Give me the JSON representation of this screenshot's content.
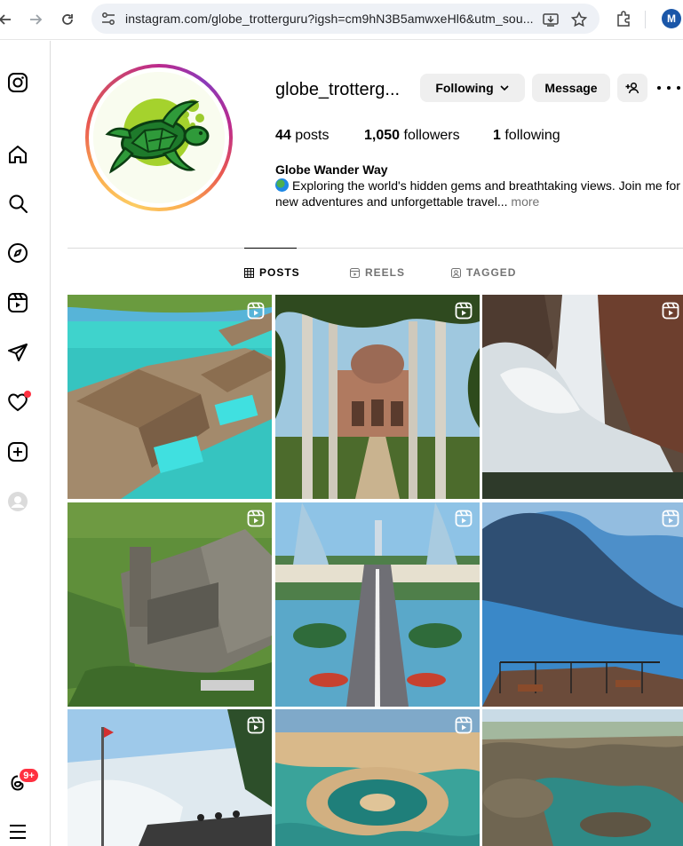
{
  "browser": {
    "url": "instagram.com/globe_trotterguru?igsh=cm9hN3B5amwxeHl6&utm_sou...",
    "profile_initial": "M"
  },
  "rail": {
    "notification_badge": "9+"
  },
  "profile": {
    "username": "globe_trotterg...",
    "following_label": "Following",
    "message_label": "Message",
    "posts_count": "44",
    "posts_label": "posts",
    "followers_count": "1,050",
    "followers_label": "followers",
    "following_count": "1",
    "following_stat_label": "following",
    "full_name": "Globe Wander Way",
    "bio_line1": "Exploring the world's hidden gems and breathtaking views. Join me for",
    "bio_line2": "new adventures and unforgettable travel...",
    "bio_more": "more"
  },
  "tabs": {
    "posts": "POSTS",
    "reels": "REELS",
    "tagged": "TAGGED"
  },
  "colors": {
    "accent_blue": "#0095f6",
    "badge_red": "#ff3040",
    "button_gray": "#efefef"
  },
  "posts": [
    {
      "subject": "overwater-villas",
      "type": "reel"
    },
    {
      "subject": "palm-avenue-tomb",
      "type": "reel"
    },
    {
      "subject": "waterfall-cliffs",
      "type": "reel"
    },
    {
      "subject": "castle-ruins",
      "type": "reel"
    },
    {
      "subject": "bridge-towers",
      "type": "reel"
    },
    {
      "subject": "lake-viewpoint",
      "type": "reel"
    },
    {
      "subject": "rhine-falls",
      "type": "reel"
    },
    {
      "subject": "island-marina",
      "type": "reel"
    },
    {
      "subject": "rocky-coast",
      "type": "reel"
    }
  ]
}
